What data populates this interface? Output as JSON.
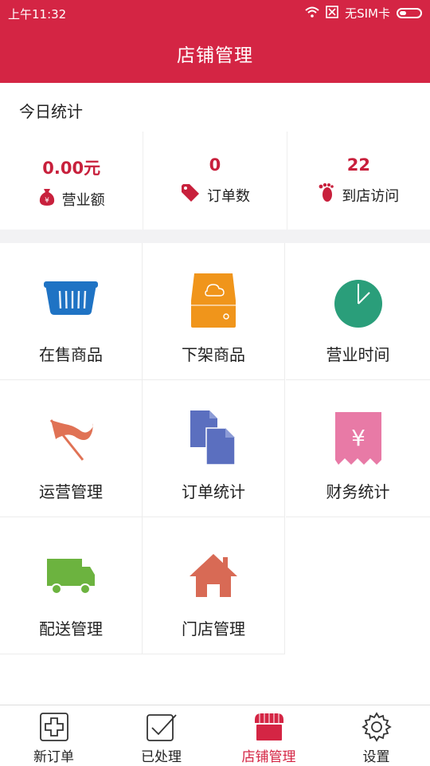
{
  "status_bar": {
    "time": "上午11:32",
    "sim": "无SIM卡"
  },
  "header": {
    "title": "店铺管理"
  },
  "today": {
    "label": "今日统计",
    "stats": [
      {
        "value": "0.00元",
        "label": "营业额",
        "icon": "money-bag-icon"
      },
      {
        "value": "0",
        "label": "订单数",
        "icon": "tag-icon"
      },
      {
        "value": "22",
        "label": "到店访问",
        "icon": "footprint-icon"
      }
    ]
  },
  "grid": [
    {
      "label": "在售商品",
      "icon": "basket-icon"
    },
    {
      "label": "下架商品",
      "icon": "archive-box-icon"
    },
    {
      "label": "营业时间",
      "icon": "clock-icon"
    },
    {
      "label": "运营管理",
      "icon": "flag-icon"
    },
    {
      "label": "订单统计",
      "icon": "documents-icon"
    },
    {
      "label": "财务统计",
      "icon": "receipt-icon"
    },
    {
      "label": "配送管理",
      "icon": "truck-icon"
    },
    {
      "label": "门店管理",
      "icon": "house-icon"
    }
  ],
  "bottom_nav": [
    {
      "label": "新订单",
      "icon": "plus-square-icon",
      "active": false
    },
    {
      "label": "已处理",
      "icon": "check-square-icon",
      "active": false
    },
    {
      "label": "店铺管理",
      "icon": "storefront-icon",
      "active": true
    },
    {
      "label": "设置",
      "icon": "gear-icon",
      "active": false
    }
  ],
  "colors": {
    "brand": "#d42544",
    "stat_value": "#c8203c",
    "basket": "#1f73c4",
    "archive": "#f0951b",
    "clock": "#2a9e7a",
    "flag": "#e07255",
    "documents": "#5b6fbf",
    "receipt": "#e87aa6",
    "truck": "#6cb33f",
    "house": "#d86a55"
  }
}
